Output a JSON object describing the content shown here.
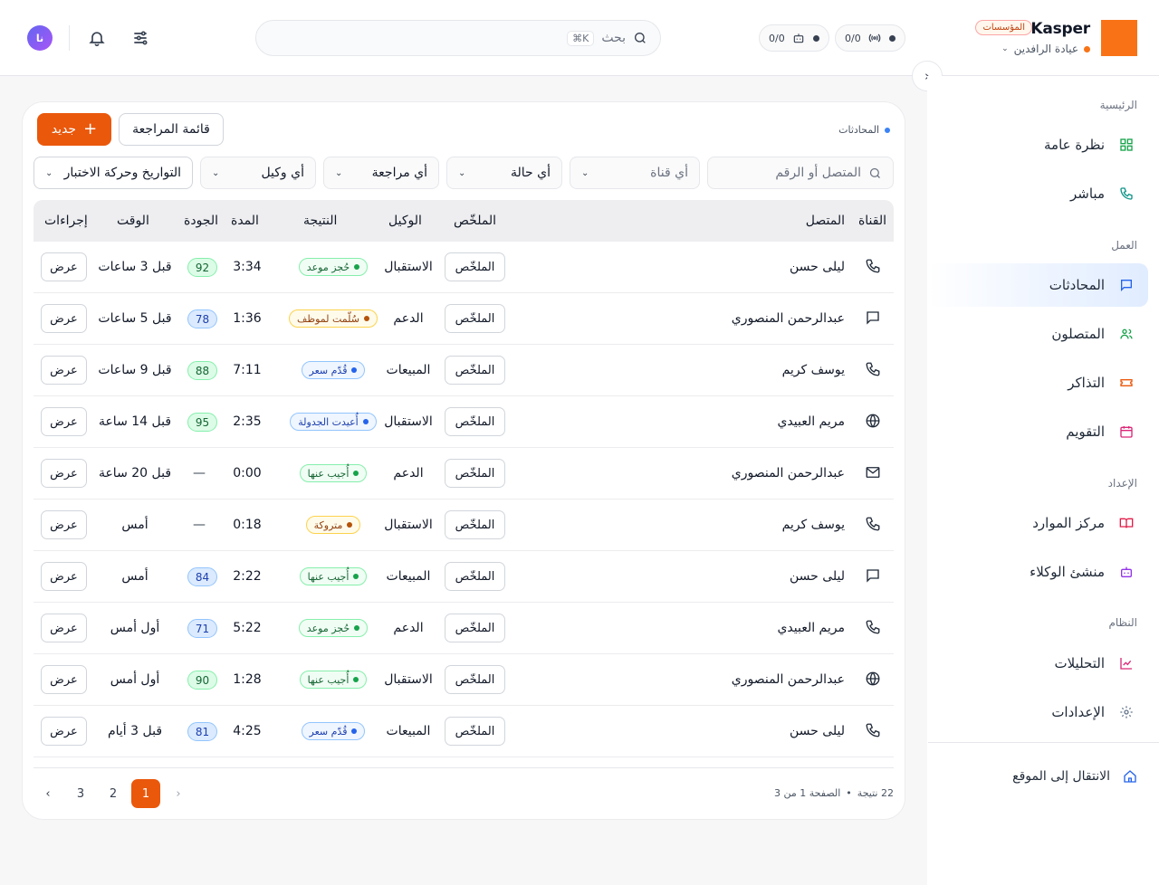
{
  "app": {
    "name": "Kasper",
    "plan": "المؤسسات",
    "clinic": "عيادة الرافدين",
    "avatar_initials": "نا",
    "accent": "#ea580c"
  },
  "stats": [
    {
      "value": "0/0",
      "icon": "radio-icon"
    },
    {
      "value": "0/0",
      "icon": "bot-icon"
    }
  ],
  "search": {
    "placeholder": "بحث",
    "shortcut": "⌘K"
  },
  "sidebar": {
    "sections": [
      "الرئيسية",
      "العمل",
      "الإعداد",
      "النظام"
    ],
    "items": [
      {
        "label": "نظرة عامة",
        "icon": "grid-icon"
      },
      {
        "label": "مباشر",
        "icon": "phone-icon"
      },
      {
        "label": "المحادثات",
        "icon": "chat-icon"
      },
      {
        "label": "المتصلون",
        "icon": "users-icon"
      },
      {
        "label": "التذاكر",
        "icon": "ticket-icon"
      },
      {
        "label": "التقويم",
        "icon": "calendar-icon"
      },
      {
        "label": "مركز الموارد",
        "icon": "book-icon"
      },
      {
        "label": "منشئ الوكلاء",
        "icon": "bot-icon"
      },
      {
        "label": "التحليلات",
        "icon": "chart-icon"
      },
      {
        "label": "الإعدادات",
        "icon": "gear-icon"
      }
    ],
    "goto_site": "الانتقال إلى الموقع"
  },
  "page": {
    "breadcrumb": "المحادثات",
    "new_button": "جديد",
    "review_button": "قائمة المراجعة",
    "filters": {
      "search_placeholder": "المتصل أو الرقم",
      "channel": "أي قناة",
      "status": "أي حالة",
      "review": "أي مراجعة",
      "agent": "أي وكيل",
      "dates": "التواريخ وحركة الاختبار"
    },
    "columns": [
      "القناة",
      "المتصل",
      "الملخّص",
      "الوكيل",
      "النتيجة",
      "المدة",
      "الجودة",
      "الوقت",
      "إجراءات"
    ],
    "summary_label": "الملخّص",
    "view_label": "عرض",
    "rows": [
      {
        "channel": "phone",
        "caller": "ليلى حسن",
        "agent": "الاستقبال",
        "result": "حُجز موعد",
        "result_tone": "green",
        "duration": "3:34",
        "quality": "92",
        "quality_tone": "green",
        "time": "قبل 3 ساعات"
      },
      {
        "channel": "chat",
        "caller": "عبدالرحمن المنصوري",
        "agent": "الدعم",
        "result": "سُلّمت لموظف",
        "result_tone": "amber",
        "duration": "1:36",
        "quality": "78",
        "quality_tone": "blue",
        "time": "قبل 5 ساعات"
      },
      {
        "channel": "phone",
        "caller": "يوسف كريم",
        "agent": "المبيعات",
        "result": "قُدّم سعر",
        "result_tone": "blue",
        "duration": "7:11",
        "quality": "88",
        "quality_tone": "green",
        "time": "قبل 9 ساعات"
      },
      {
        "channel": "web",
        "caller": "مريم العبيدي",
        "agent": "الاستقبال",
        "result": "أُعيدت الجدولة",
        "result_tone": "blue",
        "duration": "2:35",
        "quality": "95",
        "quality_tone": "green",
        "time": "قبل 14 ساعة"
      },
      {
        "channel": "email",
        "caller": "عبدالرحمن المنصوري",
        "agent": "الدعم",
        "result": "أُجيب عنها",
        "result_tone": "green",
        "duration": "0:00",
        "quality": "—",
        "quality_tone": "none",
        "time": "قبل 20 ساعة"
      },
      {
        "channel": "phone",
        "caller": "يوسف كريم",
        "agent": "الاستقبال",
        "result": "متروكة",
        "result_tone": "amber",
        "duration": "0:18",
        "quality": "—",
        "quality_tone": "none",
        "time": "أمس"
      },
      {
        "channel": "chat",
        "caller": "ليلى حسن",
        "agent": "المبيعات",
        "result": "أُجيب عنها",
        "result_tone": "green",
        "duration": "2:22",
        "quality": "84",
        "quality_tone": "blue",
        "time": "أمس"
      },
      {
        "channel": "phone",
        "caller": "مريم العبيدي",
        "agent": "الدعم",
        "result": "حُجز موعد",
        "result_tone": "green",
        "duration": "5:22",
        "quality": "71",
        "quality_tone": "blue",
        "time": "أول أمس"
      },
      {
        "channel": "web",
        "caller": "عبدالرحمن المنصوري",
        "agent": "الاستقبال",
        "result": "أُجيب عنها",
        "result_tone": "green",
        "duration": "1:28",
        "quality": "90",
        "quality_tone": "green",
        "time": "أول أمس"
      },
      {
        "channel": "phone",
        "caller": "ليلى حسن",
        "agent": "المبيعات",
        "result": "قُدّم سعر",
        "result_tone": "blue",
        "duration": "4:25",
        "quality": "81",
        "quality_tone": "blue",
        "time": "قبل 3 أيام"
      }
    ],
    "pagination": {
      "results": "22 نتيجة",
      "page_info": "الصفحة 1 من 3",
      "separator": "•",
      "pages": [
        "1",
        "2",
        "3"
      ],
      "current": "1"
    }
  }
}
